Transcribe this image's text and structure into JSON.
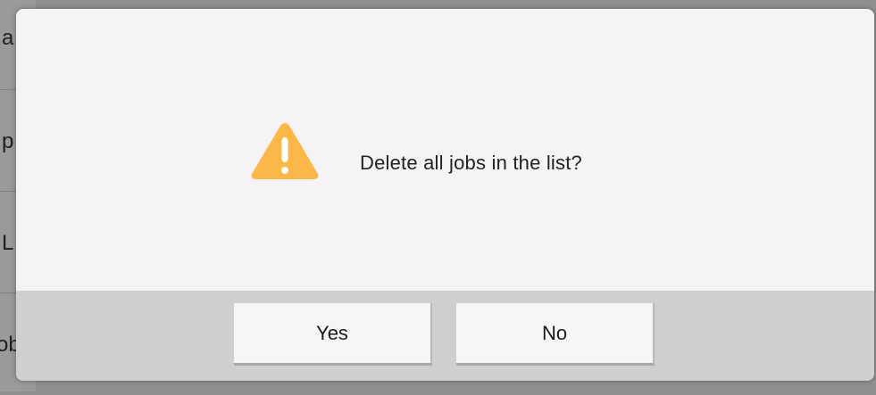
{
  "background_list": {
    "rows": [
      {
        "text": "a"
      },
      {
        "text": "p"
      },
      {
        "text": "L"
      },
      {
        "text": "ob"
      }
    ]
  },
  "dialog": {
    "icon": "warning-triangle-icon",
    "message": "Delete all jobs in the list?",
    "buttons": {
      "yes_label": "Yes",
      "no_label": "No"
    }
  },
  "colors": {
    "warning": "#fbb848",
    "dialog_bg": "#f6f3f6",
    "footer_bg": "#cfcfcf",
    "button_bg": "#f7f5f7"
  }
}
